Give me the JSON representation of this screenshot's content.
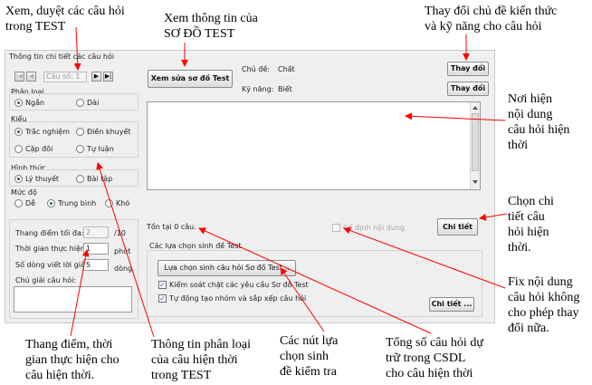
{
  "annotations": {
    "browse": [
      "Xem, duyệt các câu hỏi",
      "trong TEST"
    ],
    "view_diagram": [
      "Xem thông tin của",
      "SƠ ĐỒ TEST"
    ],
    "change_topic": [
      "Thay đổi chủ đề kiến thức",
      "và kỹ năng cho câu hỏi"
    ],
    "content": [
      "Nơi hiện",
      "nội dung",
      "câu hỏi hiện",
      "thời"
    ],
    "detail": [
      "Chọn chi",
      "tiết câu",
      "hỏi hiện",
      "thời."
    ],
    "fix": [
      "Fix nội dung",
      "câu hỏi không",
      "cho phép thay",
      "đổi nữa."
    ],
    "score": [
      "Thang điểm, thời",
      "gian thực hiện cho",
      "câu hiện thời."
    ],
    "classify": [
      "Thông tin phân loại",
      "của câu hiện thời",
      "trong TEST"
    ],
    "select_buttons": [
      "Các nút lựa",
      "chọn sinh",
      "đề kiểm tra"
    ],
    "total": [
      "Tổng số câu hỏi dự",
      "trữ trong CSDL",
      "cho câu hiện thời"
    ]
  },
  "panel": {
    "title": "Thông tin chi tiết các câu hỏi",
    "question_number": "Câu số: 1",
    "nav": {
      "first": "|◀",
      "prev": "◀",
      "next": "▶",
      "last": "▶|"
    },
    "view_diagram_button": "Xem sửa sơ đồ Test",
    "topic_label": "Chủ đề:",
    "topic_value": "Chất",
    "skill_label": "Kỹ năng:",
    "skill_value": "Biết",
    "change_button": "Thay đổi",
    "classification": {
      "label": "Phân loại",
      "options": [
        "Ngắn",
        "Dài"
      ],
      "selected": 0
    },
    "type": {
      "label": "Kiểu",
      "options": [
        "Trắc nghiệm",
        "Điền khuyết",
        "Cặp đôi",
        "Tự luận"
      ],
      "selected": 0
    },
    "form": {
      "label": "Hình thức",
      "options": [
        "Lý thuyết",
        "Bài tập"
      ],
      "selected": 0
    },
    "level": {
      "label": "Mức độ",
      "options": [
        "Dễ",
        "Trung bình",
        "Khó"
      ],
      "selected": 1
    },
    "max_score_label": "Thang điểm tối đa:",
    "max_score_value": "2",
    "max_score_suffix": "/10",
    "time_label": "Thời gian thực hiện:",
    "time_value": "1",
    "time_unit": "phút",
    "lines_label": "Số dòng viết lời giải:",
    "lines_value": "5",
    "lines_unit": "dòng",
    "note_label": "Chú giải câu hỏi:",
    "stock_text": "Tồn tại 0 câu.",
    "fix_checkbox": "Cố định nội dung",
    "detail_button": "Chi tiết",
    "generate_group": "Các lựa chọn sinh đề Test",
    "generate_button": "Lựa chọn sinh câu hỏi Sơ đồ Test...",
    "check_requirements": "Kiểm soát chặt các yêu cầu Sơ đồ Test",
    "auto_group": "Tự động tạo nhóm và sắp xếp câu hỏi",
    "detail_button2": "Chi tiết ..."
  }
}
